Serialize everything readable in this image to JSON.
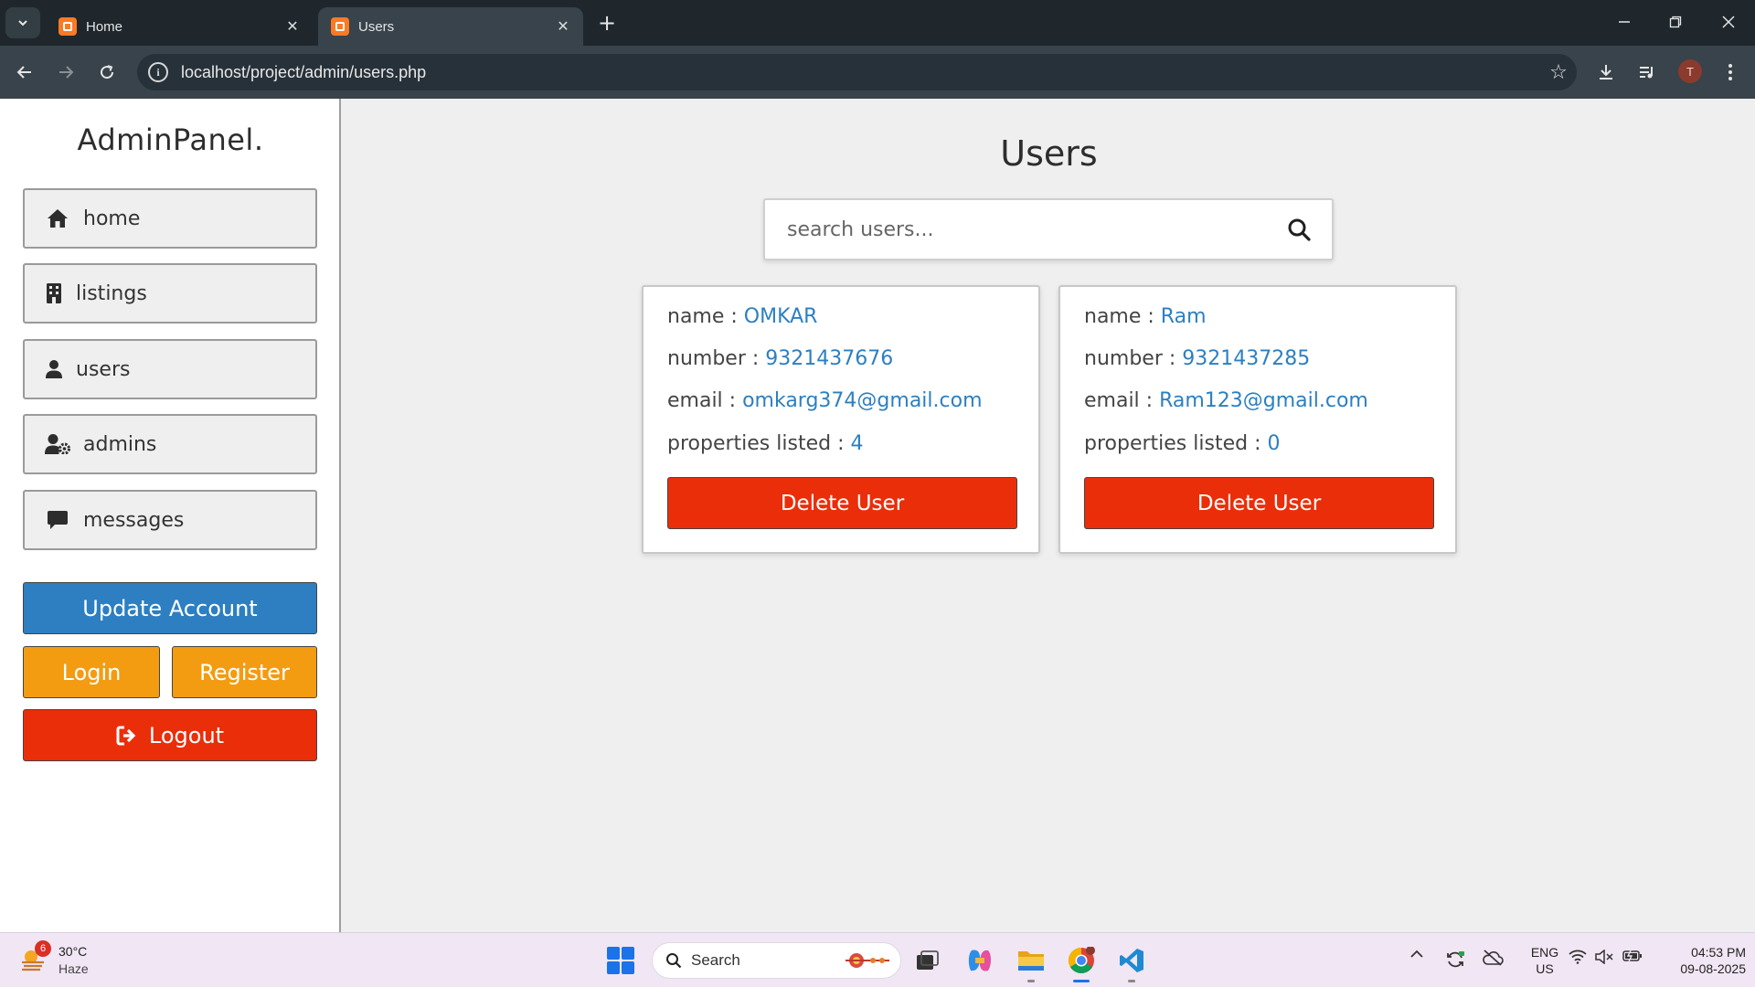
{
  "browser": {
    "tabs": [
      {
        "title": "Home",
        "active": false
      },
      {
        "title": "Users",
        "active": true
      }
    ],
    "url": "localhost/project/admin/users.php",
    "profile_initial": "T"
  },
  "sidebar": {
    "brand": "AdminPanel.",
    "items": [
      {
        "label": "home",
        "icon": "home-icon"
      },
      {
        "label": "listings",
        "icon": "building-icon"
      },
      {
        "label": "users",
        "icon": "user-icon"
      },
      {
        "label": "admins",
        "icon": "user-gear-icon"
      },
      {
        "label": "messages",
        "icon": "message-icon"
      }
    ],
    "update_label": "Update Account",
    "login_label": "Login",
    "register_label": "Register",
    "logout_label": "Logout"
  },
  "main": {
    "title": "Users",
    "search_placeholder": "search users...",
    "field_labels": {
      "name": "name : ",
      "number": "number : ",
      "email": "email : ",
      "properties": "properties listed : "
    },
    "users": [
      {
        "name": "OMKAR",
        "number": "9321437676",
        "email": "omkarg374@gmail.com",
        "properties": "4",
        "delete_label": "Delete User"
      },
      {
        "name": "Ram",
        "number": "9321437285",
        "email": "Ram123@gmail.com",
        "properties": "0",
        "delete_label": "Delete User"
      }
    ]
  },
  "taskbar": {
    "weather_badge": "6",
    "temperature": "30°C",
    "condition": "Haze",
    "search_label": "Search",
    "lang_line1": "ENG",
    "lang_line2": "US",
    "time": "04:53 PM",
    "date": "09-08-2025"
  },
  "colors": {
    "accent_blue": "#2d7fc1",
    "danger_red": "#ea2e0a",
    "warning_orange": "#f39c12"
  }
}
